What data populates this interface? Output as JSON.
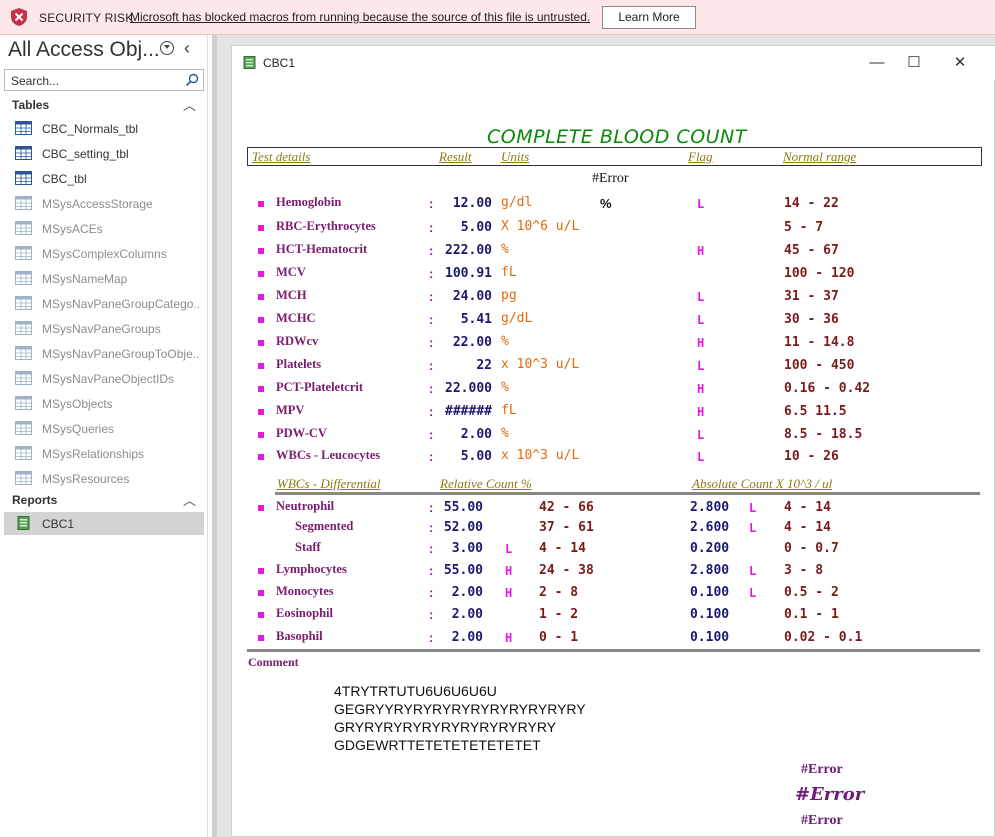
{
  "security_bar": {
    "title": "SECURITY RISK",
    "message": "Microsoft has blocked macros from running because the source of this file is untrusted.",
    "button": "Learn More"
  },
  "nav": {
    "title": "All Access Obj...",
    "search_placeholder": "Search...",
    "tables_header": "Tables",
    "tables": [
      {
        "label": "CBC_Normals_tbl",
        "system": false
      },
      {
        "label": "CBC_setting_tbl",
        "system": false
      },
      {
        "label": "CBC_tbl",
        "system": false
      },
      {
        "label": "MSysAccessStorage",
        "system": true
      },
      {
        "label": "MSysACEs",
        "system": true
      },
      {
        "label": "MSysComplexColumns",
        "system": true
      },
      {
        "label": "MSysNameMap",
        "system": true
      },
      {
        "label": "MSysNavPaneGroupCatego...",
        "system": true
      },
      {
        "label": "MSysNavPaneGroups",
        "system": true
      },
      {
        "label": "MSysNavPaneGroupToObje...",
        "system": true
      },
      {
        "label": "MSysNavPaneObjectIDs",
        "system": true
      },
      {
        "label": "MSysObjects",
        "system": true
      },
      {
        "label": "MSysQueries",
        "system": true
      },
      {
        "label": "MSysRelationships",
        "system": true
      },
      {
        "label": "MSysResources",
        "system": true
      }
    ],
    "reports_header": "Reports",
    "reports": [
      {
        "label": "CBC1",
        "selected": true
      }
    ]
  },
  "report_window": {
    "title": "CBC1"
  },
  "report": {
    "title": "COMPLETE BLOOD COUNT",
    "headers": {
      "test": "Test details",
      "result": "Result",
      "units": "Units",
      "flag": "Flag",
      "normal": "Normal range"
    },
    "error_top": "#Error",
    "percent_sign": "%",
    "tests": [
      {
        "name": "Hemoglobin",
        "value": "12.00",
        "unit": "g/dl",
        "flag": "L",
        "range": "14 - 22"
      },
      {
        "name": "RBC-Erythrocytes",
        "value": "5.00",
        "unit": "X 10^6 u/L",
        "flag": "",
        "range": "5 - 7"
      },
      {
        "name": "HCT-Hematocrit",
        "value": "222.00",
        "unit": "%",
        "flag": "H",
        "range": "45 - 67"
      },
      {
        "name": "MCV",
        "value": "100.91",
        "unit": "fL",
        "flag": "",
        "range": "100 - 120"
      },
      {
        "name": "MCH",
        "value": "24.00",
        "unit": "pg",
        "flag": "L",
        "range": "31 - 37"
      },
      {
        "name": "MCHC",
        "value": "5.41",
        "unit": "g/dL",
        "flag": "L",
        "range": "30 - 36"
      },
      {
        "name": "RDWcv",
        "value": "22.00",
        "unit": "%",
        "flag": "H",
        "range": "11 - 14.8"
      },
      {
        "name": "Platelets",
        "value": "22",
        "unit": "x 10^3 u/L",
        "flag": "L",
        "range": "100 - 450"
      },
      {
        "name": "PCT-Plateletcrit",
        "value": "22.000",
        "unit": "%",
        "flag": "H",
        "range": "0.16 - 0.42"
      },
      {
        "name": "MPV",
        "value": "######",
        "unit": "fL",
        "flag": "H",
        "range": "6.5 11.5"
      },
      {
        "name": "PDW-CV",
        "value": "2.00",
        "unit": "%",
        "flag": "L",
        "range": "8.5 - 18.5"
      },
      {
        "name": "WBCs - Leucocytes",
        "value": "5.00",
        "unit": "x 10^3 u/L",
        "flag": "L",
        "range": "10 - 26"
      }
    ],
    "diff_headers": {
      "title": "WBCs - Differential",
      "relative": "Relative Count %",
      "absolute": "Absolute Count X 10^3 / ul"
    },
    "diff": [
      {
        "name": "Neutrophil",
        "bullet": true,
        "indent": false,
        "value": "55.00",
        "rflag": "",
        "rel_range": "42 - 66",
        "abs": "2.800",
        "aflag": "L",
        "abs_range": "4 - 14"
      },
      {
        "name": "Segmented",
        "bullet": false,
        "indent": true,
        "value": "52.00",
        "rflag": "",
        "rel_range": "37 - 61",
        "abs": "2.600",
        "aflag": "L",
        "abs_range": "4 - 14"
      },
      {
        "name": "Staff",
        "bullet": false,
        "indent": true,
        "value": "3.00",
        "rflag": "L",
        "rel_range": "4 - 14",
        "abs": "0.200",
        "aflag": "",
        "abs_range": "0 - 0.7"
      },
      {
        "name": "Lymphocytes",
        "bullet": true,
        "indent": false,
        "value": "55.00",
        "rflag": "H",
        "rel_range": "24 - 38",
        "abs": "2.800",
        "aflag": "L",
        "abs_range": "3 - 8"
      },
      {
        "name": "Monocytes",
        "bullet": true,
        "indent": false,
        "value": "2.00",
        "rflag": "H",
        "rel_range": "2 - 8",
        "abs": "0.100",
        "aflag": "L",
        "abs_range": "0.5 - 2"
      },
      {
        "name": "Eosinophil",
        "bullet": true,
        "indent": false,
        "value": "2.00",
        "rflag": "",
        "rel_range": "1 - 2",
        "abs": "0.100",
        "aflag": "",
        "abs_range": "0.1 - 1"
      },
      {
        "name": "Basophil",
        "bullet": true,
        "indent": false,
        "value": "2.00",
        "rflag": "H",
        "rel_range": "0 - 1",
        "abs": "0.100",
        "aflag": "",
        "abs_range": "0.02 - 0.1"
      }
    ],
    "comment_label": "Comment",
    "comment_lines": [
      "4TRYTRTUTU6U6U6U6U",
      "GEGRYYRYRYRYRYRYRYRYRYRYRY",
      "GRYRYRYRYRYRYRYRYRYRYRY",
      "GDGEWRTTETETETETETETET"
    ],
    "footer_errors": [
      "#Error",
      "#Error",
      "#Error"
    ]
  }
}
